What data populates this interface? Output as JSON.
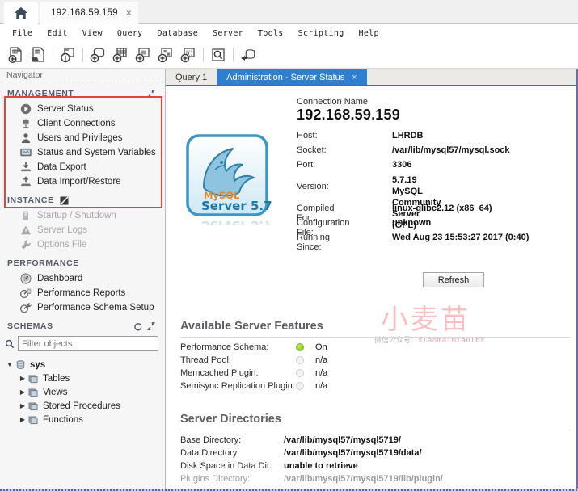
{
  "window": {
    "home_tab_icon": "home-icon",
    "connection_tab": {
      "label": "192.168.59.159",
      "close": "×"
    }
  },
  "menubar": {
    "items": [
      "File",
      "Edit",
      "View",
      "Query",
      "Database",
      "Server",
      "Tools",
      "Scripting",
      "Help"
    ]
  },
  "toolbar": {
    "buttons": [
      "new-sql-tab-icon",
      "open-sql-script-icon",
      "open-connection-inspector-icon",
      "new-schema-icon",
      "new-table-icon",
      "new-view-icon",
      "new-stored-procedure-icon",
      "new-function-icon",
      "search-data-icon",
      "reconnect-server-icon"
    ]
  },
  "navigator": {
    "title": "Navigator",
    "sections": [
      {
        "title": "MANAGEMENT",
        "highlighted": true,
        "actions": [
          "expand-icon"
        ],
        "items": [
          {
            "label": "Server Status",
            "icon": "server-status-icon",
            "enabled": true
          },
          {
            "label": "Client Connections",
            "icon": "client-connections-icon",
            "enabled": true
          },
          {
            "label": "Users and Privileges",
            "icon": "users-privileges-icon",
            "enabled": true
          },
          {
            "label": "Status and System Variables",
            "icon": "status-variables-icon",
            "enabled": true
          },
          {
            "label": "Data Export",
            "icon": "data-export-icon",
            "enabled": true
          },
          {
            "label": "Data Import/Restore",
            "icon": "data-import-icon",
            "enabled": true
          }
        ]
      },
      {
        "title": "INSTANCE",
        "highlighted": false,
        "actions": [
          "no-connection-icon"
        ],
        "items": [
          {
            "label": "Startup / Shutdown",
            "icon": "startup-shutdown-icon",
            "enabled": false
          },
          {
            "label": "Server Logs",
            "icon": "server-logs-icon",
            "enabled": false
          },
          {
            "label": "Options File",
            "icon": "options-file-icon",
            "enabled": false
          }
        ]
      },
      {
        "title": "PERFORMANCE",
        "highlighted": false,
        "actions": [],
        "items": [
          {
            "label": "Dashboard",
            "icon": "dashboard-icon",
            "enabled": true
          },
          {
            "label": "Performance Reports",
            "icon": "performance-reports-icon",
            "enabled": true
          },
          {
            "label": "Performance Schema Setup",
            "icon": "performance-schema-setup-icon",
            "enabled": true
          }
        ]
      }
    ],
    "schemas": {
      "title": "SCHEMAS",
      "actions": [
        "refresh-icon",
        "expand-icon"
      ],
      "filter": {
        "placeholder": "Filter objects",
        "value": "",
        "icon": "search-icon"
      },
      "tree": [
        {
          "label": "sys",
          "icon": "schema-icon",
          "expanded": true,
          "depth": 0
        },
        {
          "label": "Tables",
          "icon": "folder-icon",
          "expanded": false,
          "depth": 1
        },
        {
          "label": "Views",
          "icon": "folder-icon",
          "expanded": false,
          "depth": 1
        },
        {
          "label": "Stored Procedures",
          "icon": "folder-icon",
          "expanded": false,
          "depth": 1
        },
        {
          "label": "Functions",
          "icon": "folder-icon",
          "expanded": false,
          "depth": 1
        }
      ]
    }
  },
  "editor_tabs": [
    {
      "label": "Query 1",
      "active": false,
      "closable": false
    },
    {
      "label": "Administration - Server Status",
      "active": true,
      "closable": true,
      "close": "×"
    }
  ],
  "server_status": {
    "connection_name_label": "Connection Name",
    "connection_name_value": "192.168.59.159",
    "logo": {
      "product": "MySQL",
      "edition": "Server 5.7",
      "icon": "mysql-dolphin-icon"
    },
    "details": [
      {
        "key": "Host:",
        "value": "LHRDB"
      },
      {
        "key": "Socket:",
        "value": "/var/lib/mysql57/mysql.sock"
      },
      {
        "key": "Port:",
        "value": "3306"
      },
      {
        "key": "Version:",
        "value": "5.7.19\nMySQL Community Server (GPL)"
      },
      {
        "key": "Compiled For:",
        "value": "linux-glibc2.12   (x86_64)"
      },
      {
        "key": "Configuration File:",
        "value": "unknown"
      },
      {
        "key": "Running Since:",
        "value": "Wed Aug 23 15:53:27 2017 (0:40)"
      }
    ],
    "refresh_button": "Refresh",
    "features": {
      "title": "Available Server Features",
      "rows": [
        {
          "key": "Performance Schema:",
          "state": "on",
          "value": "On"
        },
        {
          "key": "Thread Pool:",
          "state": "off",
          "value": "n/a"
        },
        {
          "key": "Memcached Plugin:",
          "state": "off",
          "value": "n/a"
        },
        {
          "key": "Semisync Replication Plugin:",
          "state": "off",
          "value": "n/a"
        }
      ]
    },
    "directories": {
      "title": "Server Directories",
      "rows": [
        {
          "key": "Base Directory:",
          "value": "/var/lib/mysql57/mysql5719/",
          "muted": false
        },
        {
          "key": "Data Directory:",
          "value": "/var/lib/mysql57/mysql5719/data/",
          "muted": false
        },
        {
          "key": "Disk Space in Data Dir:",
          "value": "unable to retrieve",
          "muted": false
        },
        {
          "key": "Plugins Directory:",
          "value": "/var/lib/mysql57/mysql5719/lib/plugin/",
          "muted": true
        }
      ]
    }
  },
  "watermark": {
    "cn": "小麦苗",
    "prefix": "微信公众号：",
    "handle": "xiaomaimiaolhr"
  },
  "colors": {
    "accent": "#2f7fd0",
    "highlight_box": "#e8423a",
    "led_on": "#8fd420",
    "heading": "#5b5f63",
    "pane_border": "#6b6bbd"
  }
}
